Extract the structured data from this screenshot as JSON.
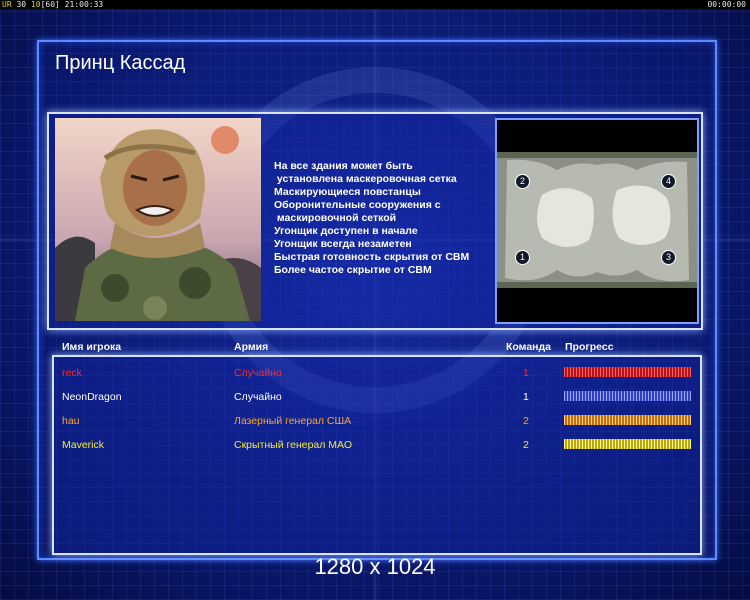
{
  "status_bar": {
    "left_prefix": "UR",
    "left_a": "30",
    "left_b": "10",
    "left_c": "[60]",
    "clock": "21:00:33",
    "right_timer": "00:00:00"
  },
  "screen_title": "Принц Кассад",
  "description_lines": [
    "На все здания может быть",
    " установлена маскеровочная сетка",
    "Маскирующиеся повстанцы",
    "Оборонительные сооружения с",
    " маскировочной сеткой",
    "Угонщик доступен в начале",
    "Угонщик всегда незаметен",
    "Быстрая готовность скрытия от СВМ",
    "Более частое скрытие от СВМ"
  ],
  "map": {
    "start_positions": [
      "2",
      "4",
      "1",
      "3"
    ]
  },
  "table": {
    "headers": {
      "player": "Имя игрока",
      "army": "Армия",
      "team": "Команда",
      "progress": "Прогресс"
    },
    "rows": [
      {
        "player": "reck",
        "army": "Случайно",
        "team": "1",
        "color": "#ff2a2a",
        "progress": 1.0,
        "bar_color": "#e0303a"
      },
      {
        "player": "NeonDragon",
        "army": "Случайно",
        "team": "1",
        "color": "#ffffff",
        "progress": 1.0,
        "bar_color": "#6a7cff"
      },
      {
        "player": "hau",
        "army": "Лазерный генерал США",
        "team": "2",
        "color": "#ffa81e",
        "progress": 1.0,
        "bar_color": "#f0a030"
      },
      {
        "player": "Maverick",
        "army": "Скрытный генерал МАО",
        "team": "2",
        "color": "#f5e83c",
        "progress": 1.0,
        "bar_color": "#e8e040"
      }
    ]
  },
  "resolution_label": "1280 x 1024"
}
